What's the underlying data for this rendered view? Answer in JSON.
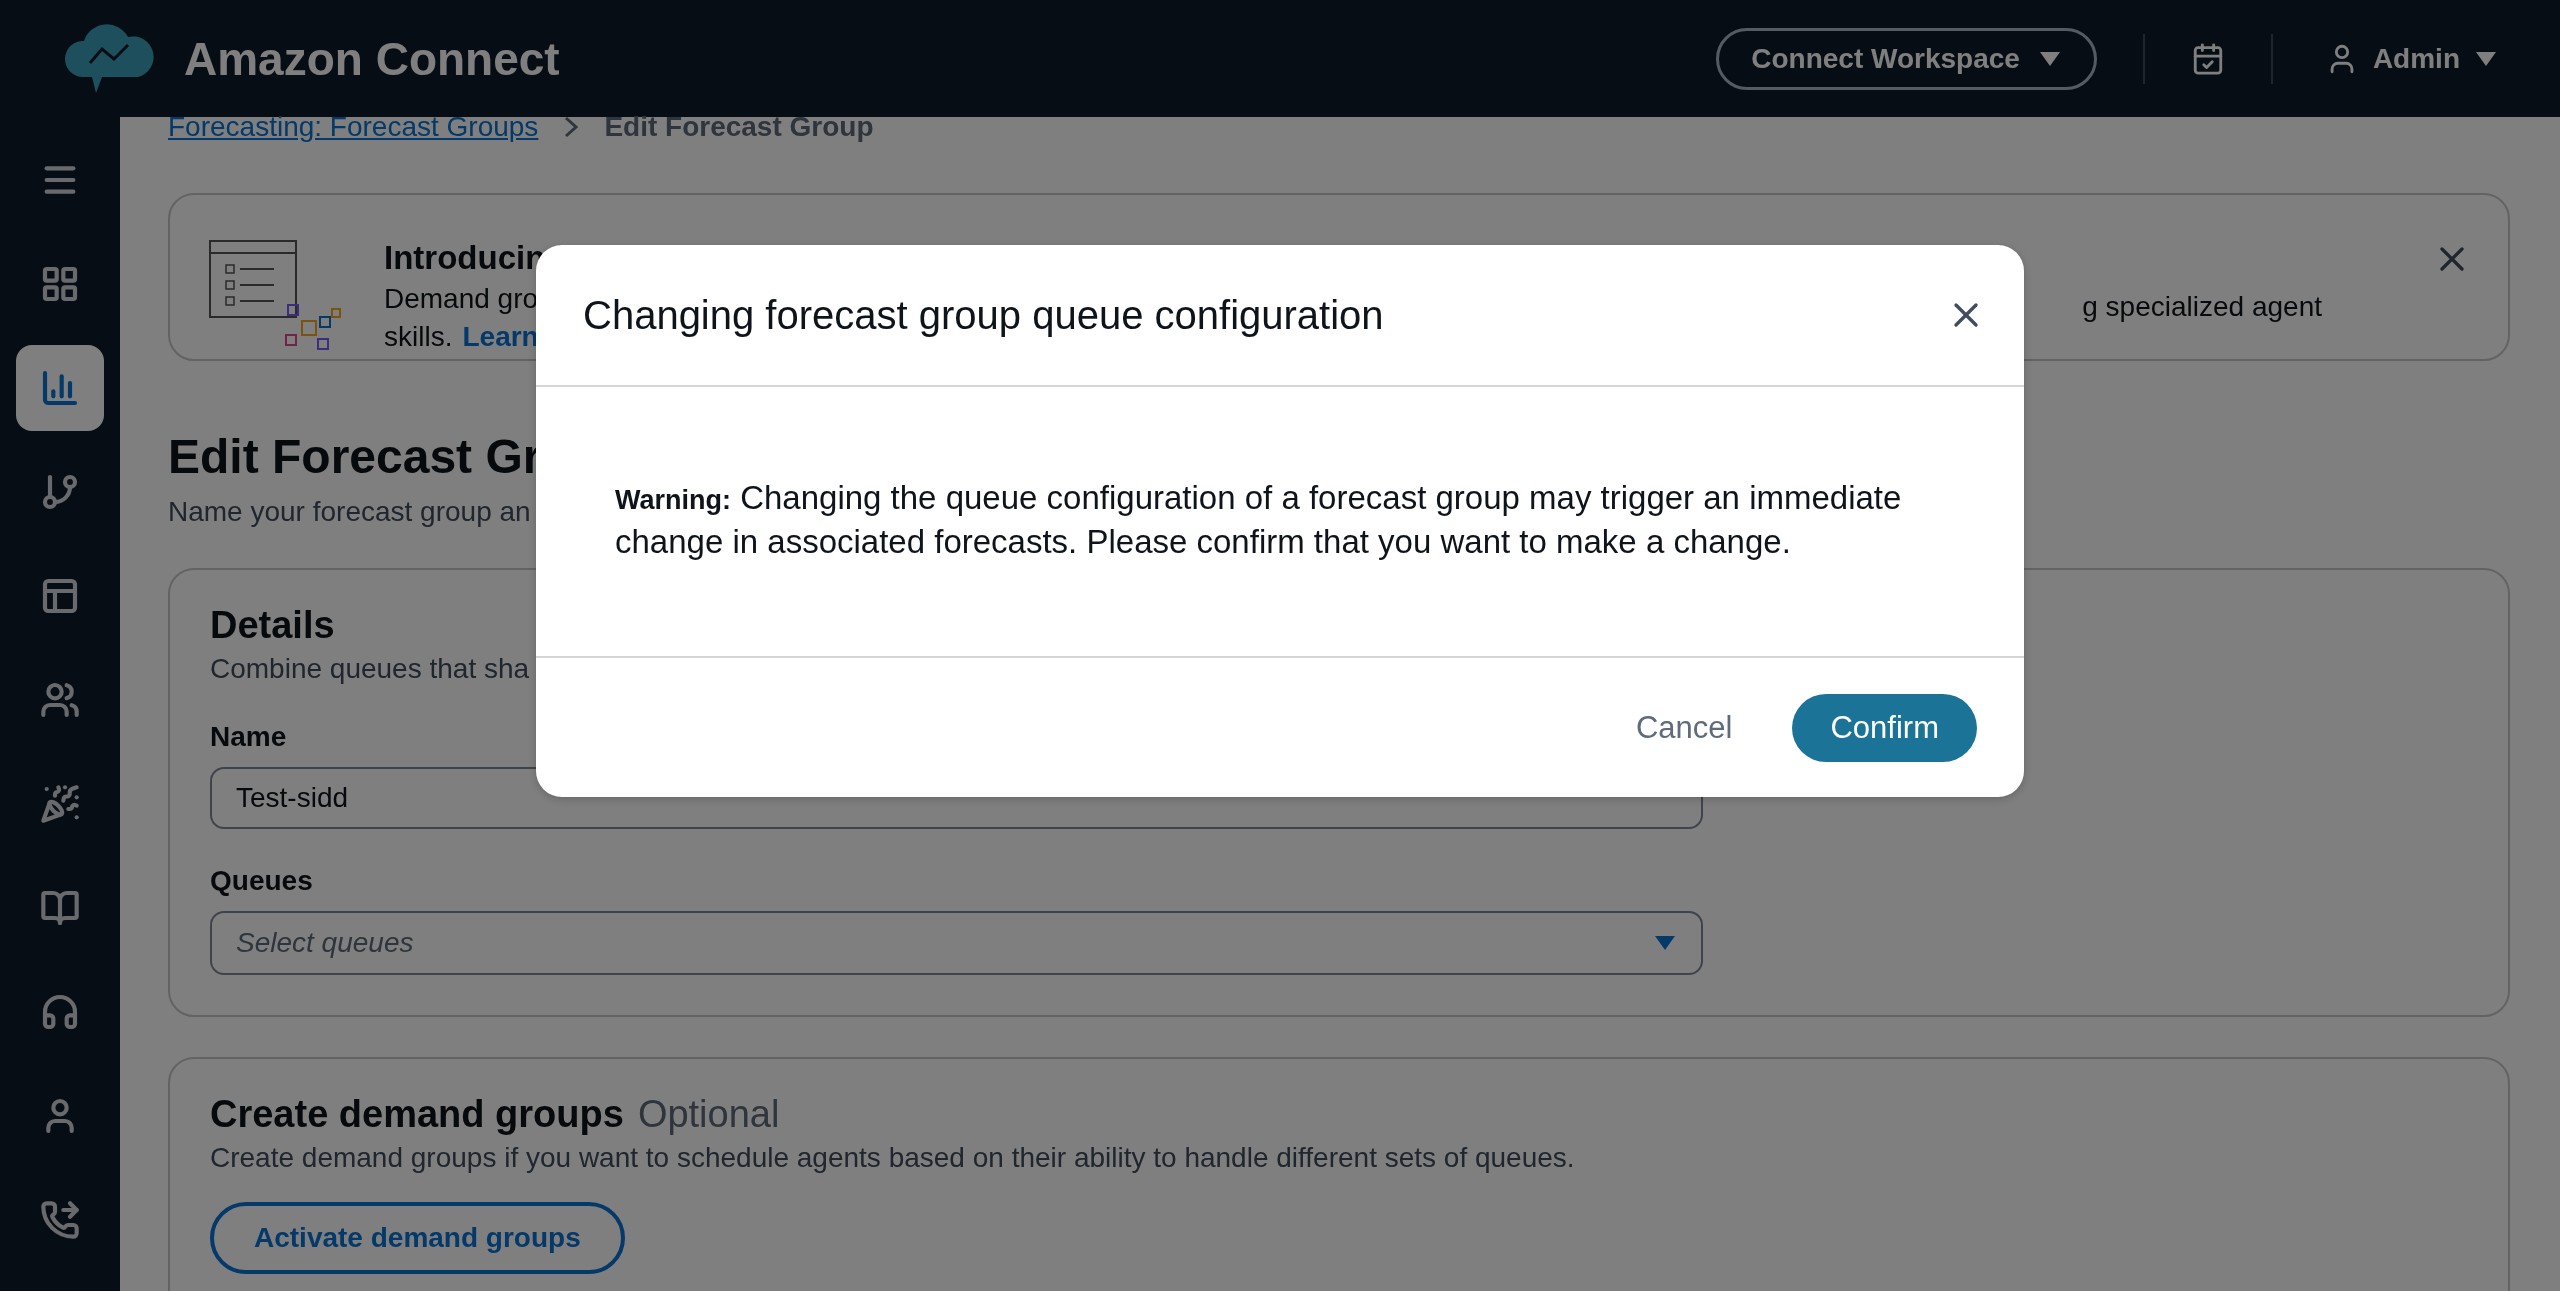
{
  "topbar": {
    "product": "Amazon Connect",
    "workspace_button": "Connect Workspace",
    "user": "Admin"
  },
  "sidebar": {
    "items": [
      {
        "kind": "menu",
        "selected": false
      },
      {
        "kind": "dashboard",
        "selected": false
      },
      {
        "kind": "analytics",
        "selected": true
      },
      {
        "kind": "routing",
        "selected": false
      },
      {
        "kind": "layout",
        "selected": false
      },
      {
        "kind": "users",
        "selected": false
      },
      {
        "kind": "campaigns",
        "selected": false
      },
      {
        "kind": "knowledge",
        "selected": false
      },
      {
        "kind": "agent",
        "selected": false
      },
      {
        "kind": "user",
        "selected": false
      },
      {
        "kind": "channels",
        "selected": false
      }
    ]
  },
  "breadcrumb": [
    {
      "label": "Forecasting: Forecast Groups",
      "kind": "link"
    },
    {
      "label": "Edit Forecast Group",
      "kind": "current"
    }
  ],
  "banner": {
    "title": "Introducin",
    "line_1": "Demand gro",
    "line_2": "skills.",
    "link": "Learn",
    "line_right": "g specialized agent"
  },
  "page": {
    "title": "Edit Forecast Gr",
    "subtitle": "Name your forecast group an"
  },
  "details": {
    "title": "Details",
    "description": "Combine queues that sha",
    "name_label": "Name",
    "name_value": "Test-sidd",
    "queues_label": "Queues",
    "queues_placeholder": "Select queues"
  },
  "demand_groups": {
    "title": "Create demand groups",
    "optional": "Optional",
    "description": "Create demand groups if you want to schedule agents based on their ability to handle different sets of queues.",
    "button": "Activate demand groups"
  },
  "modal": {
    "title": "Changing forecast group queue configuration",
    "message": "**Warning:** Changing the queue configuration of a forecast group may trigger an immediate change in associated forecasts. Please confirm that you want to make a change.",
    "cancel": "Cancel",
    "confirm": "Confirm"
  }
}
